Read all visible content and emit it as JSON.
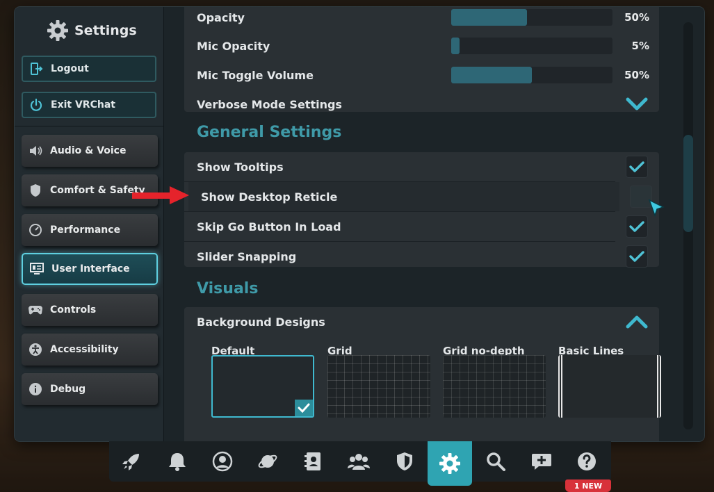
{
  "window": {
    "title": "Settings"
  },
  "sidebar": {
    "logout_label": "Logout",
    "exit_label": "Exit VRChat",
    "items": [
      {
        "label": "Audio & Voice",
        "icon": "speaker-icon"
      },
      {
        "label": "Comfort & Safety",
        "icon": "shield-icon"
      },
      {
        "label": "Performance",
        "icon": "gauge-icon"
      },
      {
        "label": "User Interface",
        "icon": "ui-screen-icon",
        "active": true
      },
      {
        "label": "Controls",
        "icon": "gamepad-icon"
      },
      {
        "label": "Accessibility",
        "icon": "accessibility-icon"
      },
      {
        "label": "Debug",
        "icon": "info-icon"
      }
    ]
  },
  "audio_rows": {
    "opacity": {
      "label": "Opacity",
      "value": "50%",
      "level": 0.47
    },
    "mic_opacity": {
      "label": "Mic Opacity",
      "value": "5%",
      "level": 0.05
    },
    "mic_toggle_volume": {
      "label": "Mic Toggle Volume",
      "value": "50%",
      "level": 0.5
    },
    "verbose_mode": {
      "label": "Verbose Mode Settings"
    }
  },
  "general": {
    "title": "General Settings",
    "rows": [
      {
        "label": "Show Tooltips",
        "checked": true
      },
      {
        "label": "Show Desktop Reticle",
        "checked": false
      },
      {
        "label": "Skip Go Button In Load",
        "checked": true
      },
      {
        "label": "Slider Snapping",
        "checked": true
      }
    ]
  },
  "visuals": {
    "title": "Visuals",
    "background_designs_label": "Background Designs",
    "options": [
      {
        "label": "Default",
        "selected": true
      },
      {
        "label": "Grid"
      },
      {
        "label": "Grid no-depth"
      },
      {
        "label": "Basic Lines"
      }
    ]
  },
  "dock": {
    "items": [
      "rocket-icon",
      "bell-icon",
      "user-icon",
      "planet-icon",
      "contacts-icon",
      "group-icon",
      "shield-icon",
      "settings-gear-icon",
      "search-icon",
      "chat-add-icon",
      "help-icon"
    ],
    "active_index": 7,
    "badge": "1 NEW"
  },
  "colors": {
    "accent": "#3f9aa8",
    "check": "#4fc3d6",
    "badge": "#d8323a"
  }
}
